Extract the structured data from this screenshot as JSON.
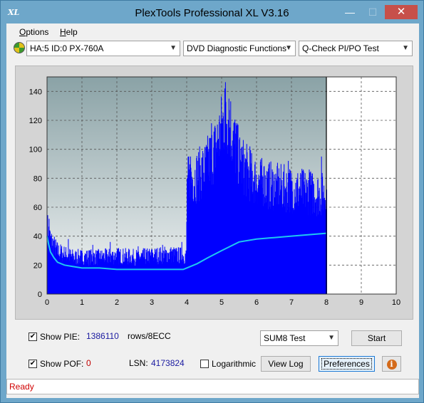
{
  "window": {
    "title": "PlexTools Professional XL V3.16",
    "icon_text": "XL",
    "minimize": "—",
    "maximize": "☐",
    "close": "✕"
  },
  "menu": {
    "options_u": "O",
    "options_rest": "ptions",
    "help_u": "H",
    "help_rest": "elp"
  },
  "toolbar": {
    "drive": "HA:5 ID:0  PX-760A",
    "function": "DVD Diagnostic Functions",
    "test": "Q-Check PI/PO Test"
  },
  "chart_data": {
    "type": "area",
    "title": "",
    "xlabel": "",
    "ylabel": "",
    "xlim": [
      0,
      10
    ],
    "ylim": [
      0,
      150
    ],
    "x_ticks": [
      "0",
      "1",
      "2",
      "3",
      "4",
      "5",
      "6",
      "7",
      "8",
      "9",
      "10"
    ],
    "y_ticks": [
      "0",
      "20",
      "40",
      "60",
      "80",
      "100",
      "120",
      "140"
    ],
    "grid": true,
    "scanned_end_x": 8.0,
    "series": [
      {
        "color": "#0000ff",
        "kind": "bars",
        "x": [
          0.0,
          0.05,
          0.1,
          0.2,
          0.3,
          0.5,
          0.75,
          1.0,
          1.5,
          2.0,
          2.5,
          3.0,
          3.5,
          3.9,
          3.98,
          4.0,
          4.02,
          4.2,
          4.5,
          4.8,
          5.0,
          5.1,
          5.2,
          5.3,
          5.5,
          5.8,
          6.0,
          6.5,
          7.0,
          7.5,
          8.0
        ],
        "y": [
          48,
          42,
          38,
          34,
          30,
          28,
          26,
          26,
          26,
          27,
          26,
          27,
          28,
          27,
          27,
          75,
          80,
          82,
          88,
          102,
          118,
          128,
          124,
          112,
          94,
          84,
          80,
          76,
          74,
          72,
          70
        ],
        "peaks": [
          [
            0.05,
            52
          ],
          [
            0.6,
            38
          ],
          [
            1.3,
            34
          ],
          [
            1.8,
            36
          ],
          [
            2.6,
            33
          ],
          [
            3.3,
            34
          ],
          [
            3.85,
            36
          ],
          [
            4.1,
            95
          ],
          [
            4.7,
            118
          ],
          [
            5.08,
            142
          ],
          [
            5.2,
            135
          ],
          [
            5.4,
            118
          ],
          [
            5.8,
            102
          ],
          [
            6.2,
            88
          ],
          [
            6.9,
            92
          ],
          [
            7.5,
            86
          ],
          [
            7.85,
            95
          ]
        ]
      },
      {
        "color": "#1ec8f0",
        "kind": "line",
        "x": [
          0.0,
          0.05,
          0.1,
          0.2,
          0.3,
          0.5,
          0.75,
          1.0,
          1.5,
          2.0,
          2.5,
          3.0,
          3.5,
          3.9,
          4.0,
          4.3,
          4.6,
          5.0,
          5.5,
          6.0,
          6.5,
          7.0,
          7.5,
          8.0
        ],
        "y": [
          40,
          34,
          29,
          25,
          22,
          20,
          19,
          18,
          18,
          17,
          17,
          17,
          17,
          17,
          18,
          21,
          25,
          30,
          36,
          38,
          39,
          40,
          41,
          42
        ]
      }
    ]
  },
  "controls": {
    "show_pie_label": "Show PIE:",
    "pie_value": "1386110",
    "pie_unit": "rows/8ECC",
    "show_pof_label": "Show POF:",
    "pof_value": "0",
    "lsn_label": "LSN:",
    "lsn_value": "4173824",
    "log_label": "Logarithmic",
    "test_mode": "SUM8 Test",
    "start": "Start",
    "view_log": "View Log",
    "preferences": "Preferences",
    "info": "i"
  },
  "status": {
    "text": "Ready"
  }
}
